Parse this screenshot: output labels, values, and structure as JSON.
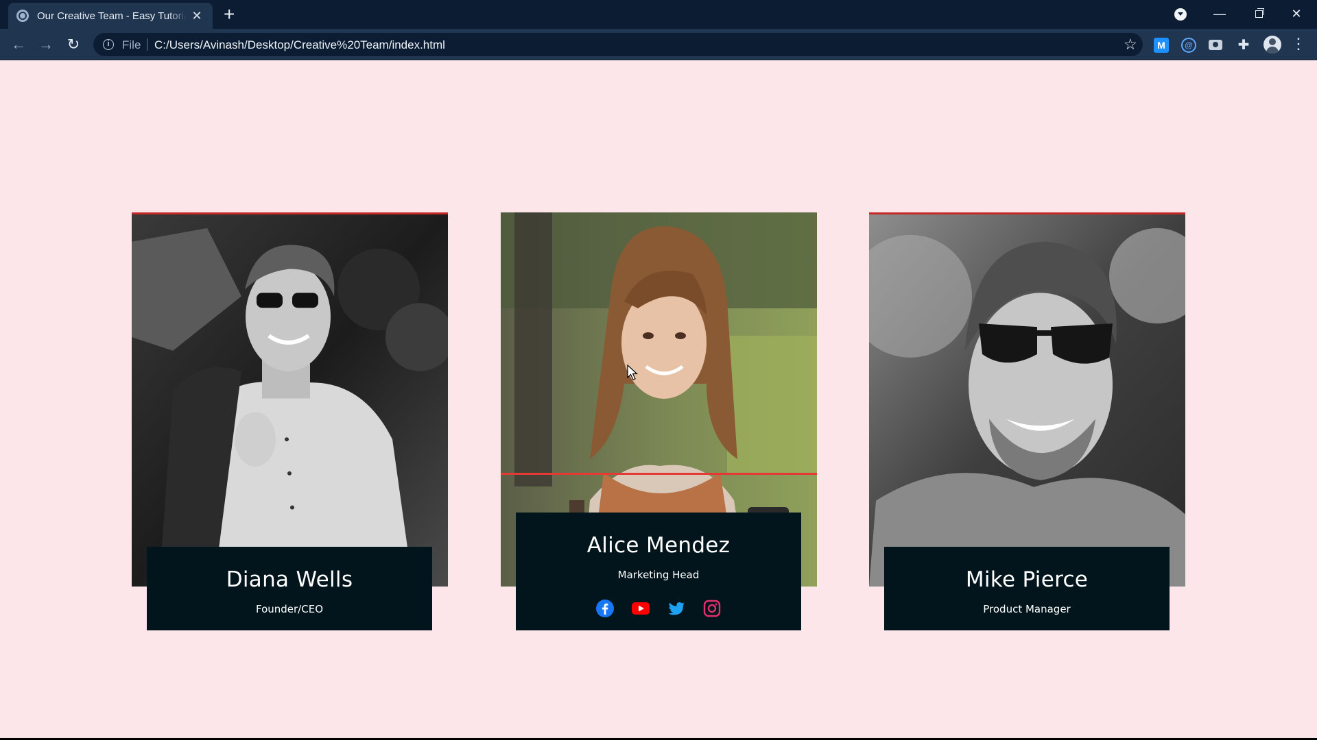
{
  "browser": {
    "tab_title": "Our Creative Team - Easy Tutorials",
    "tab_close": "✕",
    "new_tab": "+",
    "scheme": "File",
    "url": "C:/Users/Avinash/Desktop/Creative%20Team/index.html",
    "extensions": [
      "M",
      "@"
    ],
    "icons": [
      "globe-icon",
      "close-icon",
      "plus-icon",
      "back-arrow-icon",
      "forward-arrow-icon",
      "reload-icon",
      "info-icon",
      "star-icon",
      "camera-icon",
      "puzzle-icon",
      "avatar-icon",
      "more-icon"
    ]
  },
  "team": {
    "members": [
      {
        "name": "Diana Wells",
        "role": "Founder/CEO"
      },
      {
        "name": "Alice Mendez",
        "role": "Marketing Head"
      },
      {
        "name": "Mike Pierce",
        "role": "Product Manager"
      }
    ],
    "socials": [
      {
        "icon": "facebook-icon",
        "color": "#1877f2"
      },
      {
        "icon": "youtube-icon",
        "color": "#ff0000"
      },
      {
        "icon": "twitter-icon",
        "color": "#1da1f2"
      },
      {
        "icon": "instagram-icon",
        "color": "#e1306c"
      }
    ]
  },
  "theme": {
    "page_background": "#fde6ea",
    "card_background": "#02151c",
    "accent_red": "#e53935"
  }
}
